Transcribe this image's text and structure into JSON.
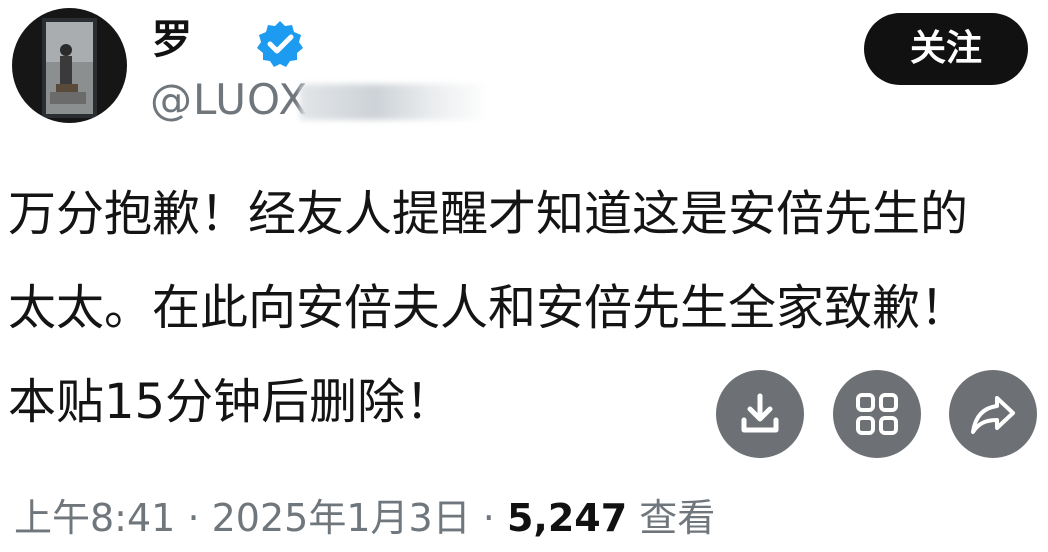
{
  "profile": {
    "name": "罗",
    "handle": "@LUOX",
    "follow_label": "关注"
  },
  "post": {
    "line1": "万分抱歉！经友人提醒才知道这是安倍先生的",
    "line2": "太太。在此向安倍夫人和安倍先生全家致歉！",
    "line3": "本贴15分钟后删除！"
  },
  "meta": {
    "time": "上午8:41",
    "sep1": "·",
    "date": "2025年1月3日",
    "sep2": "·",
    "views": "5,247",
    "views_label": "查看"
  },
  "actions": [
    "download-icon",
    "grid-icon",
    "share-icon"
  ],
  "colors": {
    "verified": "#1d9bf0",
    "follow_bg": "#111111",
    "action_bg": "#6d7175",
    "muted_text": "#6f767c"
  }
}
